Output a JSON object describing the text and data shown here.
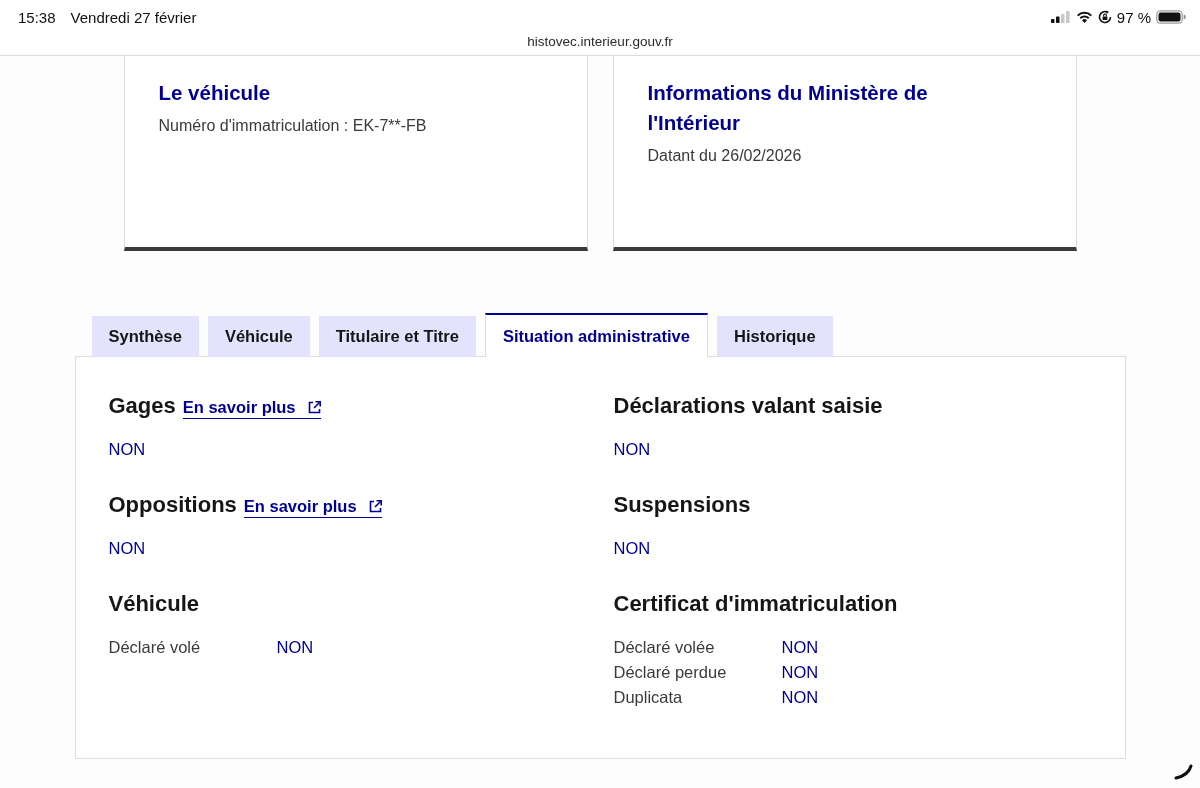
{
  "status_bar": {
    "time": "15:38",
    "date": "Vendredi 27 février",
    "battery": "97 %"
  },
  "address_bar": {
    "url": "histovec.interieur.gouv.fr"
  },
  "cards": [
    {
      "title": "Le véhicule",
      "text": "Numéro d'immatriculation : EK-7**-FB"
    },
    {
      "title": "Informations du Ministère de l'Intérieur",
      "text": "Datant du 26/02/2026"
    }
  ],
  "tabs": [
    {
      "label": "Synthèse",
      "selected": false
    },
    {
      "label": "Véhicule",
      "selected": false
    },
    {
      "label": "Titulaire et Titre",
      "selected": false
    },
    {
      "label": "Situation administrative",
      "selected": true
    },
    {
      "label": "Historique",
      "selected": false
    }
  ],
  "panel": {
    "columns": [
      {
        "sections": [
          {
            "title": "Gages",
            "link": "En savoir plus",
            "rows": [
              {
                "value": "NON"
              }
            ]
          },
          {
            "title": "Oppositions",
            "link": "En savoir plus",
            "rows": [
              {
                "value": "NON"
              }
            ]
          },
          {
            "title": "Véhicule",
            "rows": [
              {
                "label": "Déclaré volé",
                "value": "NON"
              }
            ]
          }
        ]
      },
      {
        "sections": [
          {
            "title": "Déclarations valant saisie",
            "rows": [
              {
                "value": "NON"
              }
            ]
          },
          {
            "title": "Suspensions",
            "rows": [
              {
                "value": "NON"
              }
            ]
          },
          {
            "title": "Certificat d'immatriculation",
            "rows": [
              {
                "label": "Déclaré volée",
                "value": "NON"
              },
              {
                "label": "Déclaré perdue",
                "value": "NON"
              },
              {
                "label": "Duplicata",
                "value": "NON"
              }
            ]
          }
        ]
      }
    ]
  }
}
